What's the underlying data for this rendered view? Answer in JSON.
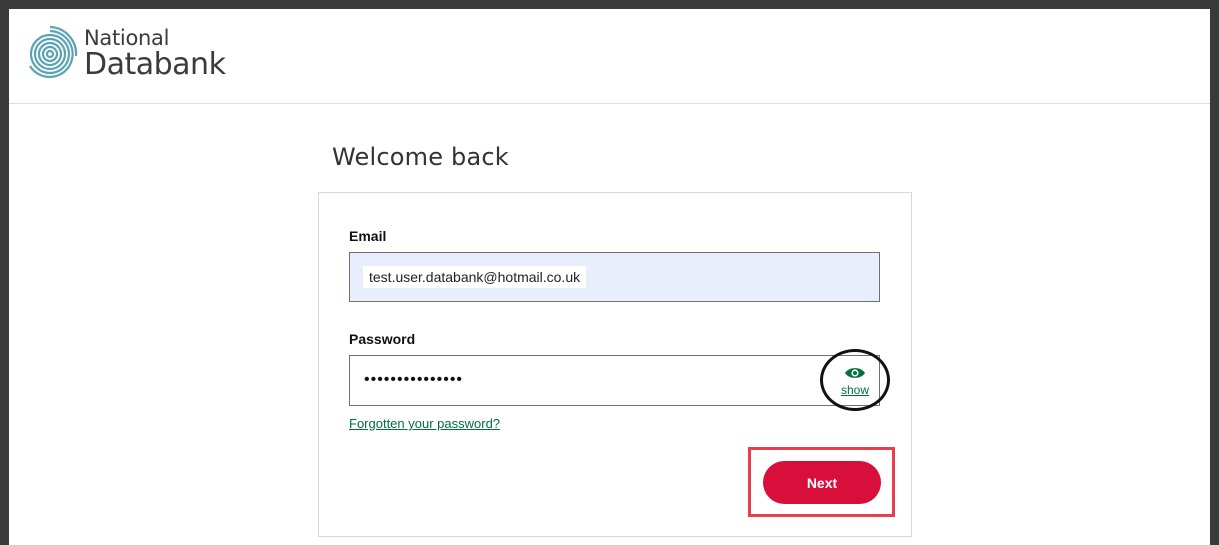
{
  "brand": {
    "name_line1": "National",
    "name_line2": "Databank",
    "logo_icon": "fingerprint-icon",
    "logo_color": "#5aa3b5"
  },
  "page": {
    "heading": "Welcome back"
  },
  "form": {
    "email_label": "Email",
    "email_value": "test.user.databank@hotmail.co.uk",
    "password_label": "Password",
    "password_value": "•••••••••••••••",
    "show_label": "show",
    "show_icon": "eye-icon",
    "forgot_label": "Forgotten your password?",
    "next_label": "Next"
  },
  "colors": {
    "primary_button": "#d70f3a",
    "link": "#00703c",
    "autofill_bg": "#e8eefc",
    "highlight_box": "#e8404a"
  }
}
